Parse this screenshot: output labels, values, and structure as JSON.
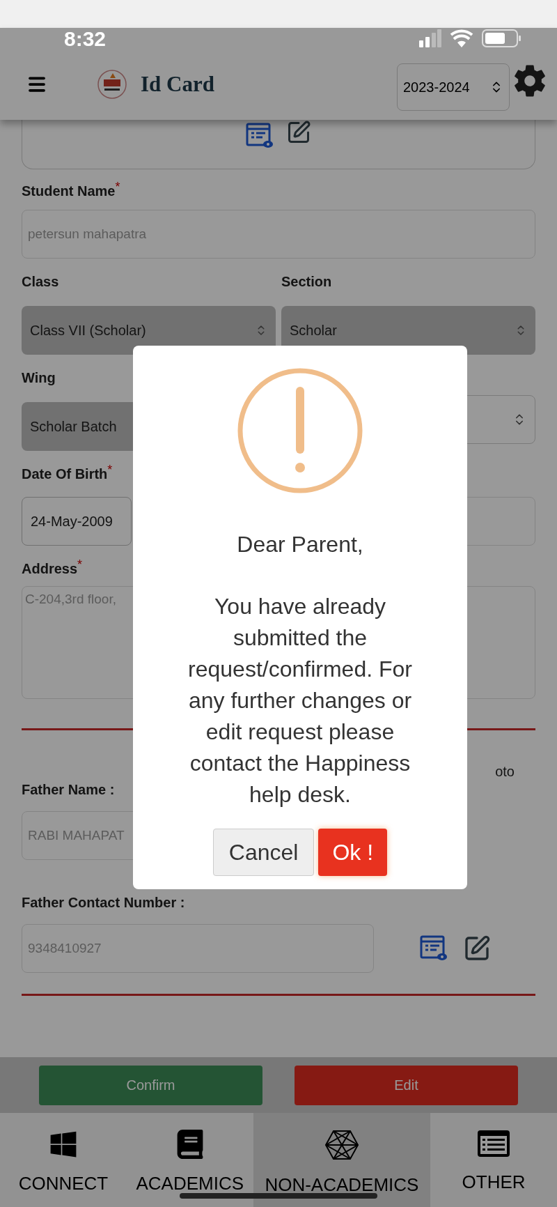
{
  "status_bar": {
    "time": "8:32"
  },
  "header": {
    "title": "Id Card",
    "year": "2023-2024"
  },
  "form": {
    "student_name": {
      "label": "Student Name",
      "required_mark": "*",
      "value": "petersun  mahapatra"
    },
    "class": {
      "label": "Class",
      "value": "Class VII (Scholar)"
    },
    "section": {
      "label": "Section",
      "value": "Scholar"
    },
    "wing": {
      "label": "Wing",
      "value": "Scholar Batch"
    },
    "dob": {
      "label": "Date Of Birth",
      "required_mark": "*",
      "value": "24-May-2009"
    },
    "address": {
      "label": "Address",
      "required_mark": "*",
      "value": "C-204,3rd floor,"
    },
    "father_name": {
      "label": "Father Name :",
      "value": "RABI MAHAPAT"
    },
    "photo_label_fragment": "oto",
    "father_contact": {
      "label": "Father Contact Number :",
      "value": "9348410927"
    }
  },
  "actions": [
    {
      "label": "Confirm",
      "kind": "confirm"
    },
    {
      "label": "Edit",
      "kind": "edit"
    }
  ],
  "tabs": [
    {
      "label": "CONNECT",
      "kind": "windows",
      "selected": false
    },
    {
      "label": "ACADEMICS",
      "kind": "book",
      "selected": false
    },
    {
      "label": "NON-ACADEMICS",
      "kind": "hexagon",
      "selected": true
    },
    {
      "label": "OTHER",
      "kind": "list",
      "selected": false
    }
  ],
  "dialog": {
    "greeting": "Dear Parent,",
    "message": "You have already submitted the request/confirmed. For any further changes or edit request please contact the Happiness help desk.",
    "buttons": [
      {
        "label": "Cancel",
        "kind": "secondary"
      },
      {
        "label": "Ok !",
        "kind": "primary"
      }
    ]
  }
}
